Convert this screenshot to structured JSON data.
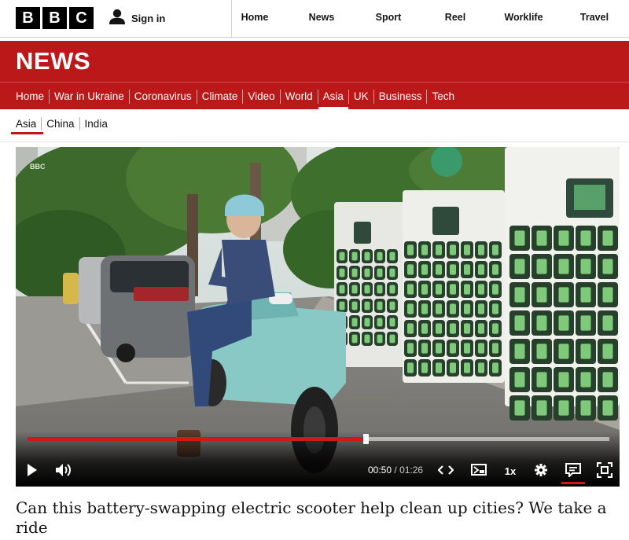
{
  "brand": {
    "letters": [
      "B",
      "B",
      "C"
    ]
  },
  "account": {
    "signin_label": "Sign in"
  },
  "topnav": {
    "items": [
      {
        "label": "Home"
      },
      {
        "label": "News"
      },
      {
        "label": "Sport"
      },
      {
        "label": "Reel"
      },
      {
        "label": "Worklife"
      },
      {
        "label": "Travel"
      }
    ]
  },
  "section": {
    "title": "NEWS"
  },
  "sectionnav": {
    "items": [
      {
        "label": "Home"
      },
      {
        "label": "War in Ukraine"
      },
      {
        "label": "Coronavirus"
      },
      {
        "label": "Climate"
      },
      {
        "label": "Video"
      },
      {
        "label": "World"
      },
      {
        "label": "Asia",
        "active": true
      },
      {
        "label": "UK"
      },
      {
        "label": "Business"
      },
      {
        "label": "Tech"
      }
    ]
  },
  "subnav": {
    "items": [
      {
        "label": "Asia",
        "active": true
      },
      {
        "label": "China"
      },
      {
        "label": "India"
      }
    ]
  },
  "player": {
    "watermark": "BBC",
    "current_time": "00:50",
    "time_separator": "/",
    "duration": "01:26",
    "progress_fraction": 0.581,
    "speed_label": "1x",
    "icons": {
      "play": "play-icon",
      "volume": "volume-icon",
      "embed": "embed-icon",
      "picture_in_picture": "picture-in-picture-icon",
      "settings": "gear-icon",
      "captions": "captions-icon",
      "fullscreen": "fullscreen-icon"
    },
    "accent_color": "#d11818"
  },
  "article": {
    "headline": "Can this battery-swapping electric scooter help clean up cities? We take a ride"
  },
  "colors": {
    "news_red": "#bb1919",
    "text": "#141414"
  }
}
